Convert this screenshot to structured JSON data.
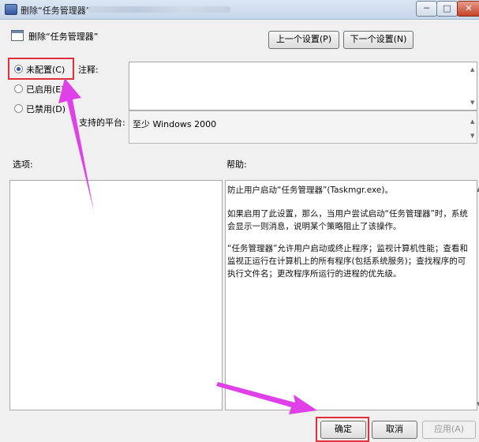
{
  "window": {
    "title": "删除“任务管理器”",
    "controls": {
      "minimize": "─",
      "maximize": "□",
      "close": "✕"
    }
  },
  "header": {
    "setting_title": "删除“任务管理器”",
    "prev_button": "上一个设置(P)",
    "next_button": "下一个设置(N)"
  },
  "radios": [
    {
      "label": "未配置(C)",
      "checked": true
    },
    {
      "label": "已启用(E)",
      "checked": false
    },
    {
      "label": "已禁用(D)",
      "checked": false
    }
  ],
  "comment": {
    "label": "注释:",
    "value": ""
  },
  "platform": {
    "label": "支持的平台:",
    "value": "至少 Windows 2000"
  },
  "options": {
    "label": "选项:"
  },
  "help": {
    "label": "帮助:",
    "paragraphs": [
      "防止用户启动“任务管理器”(Taskmgr.exe)。",
      "如果启用了此设置，那么，当用户尝试启动“任务管理器”时，系统会显示一则消息，说明某个策略阻止了该操作。",
      "“任务管理器”允许用户启动或终止程序；监视计算机性能；查看和监视正运行在计算机上的所有程序(包括系统服务)；查找程序的可执行文件名；更改程序所运行的进程的优先级。"
    ]
  },
  "footer": {
    "ok": "确定",
    "cancel": "取消",
    "apply": "应用(A)"
  },
  "colors": {
    "highlight": "#e0303b",
    "arrow": "#e040e8"
  }
}
